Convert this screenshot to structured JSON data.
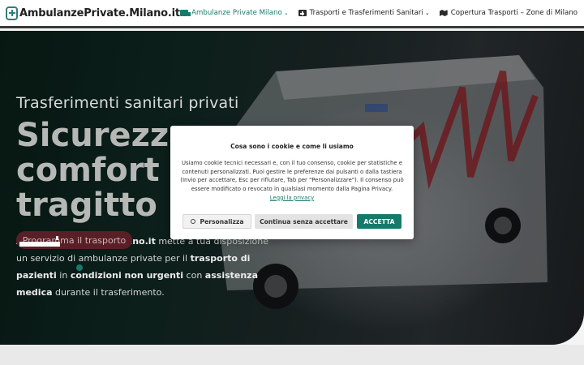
{
  "header": {
    "logo_text": "AmbulanzePrivate.Milano.it",
    "nav": [
      {
        "label": "Ambulanze Private Milano",
        "icon": "ambulance-icon",
        "active": true
      },
      {
        "label": "Trasporti e Trasferimenti Sanitari",
        "icon": "medical-kit-icon",
        "active": false
      },
      {
        "label": "Copertura Trasporti – Zone di Milano",
        "icon": "map-icon",
        "active": false
      }
    ]
  },
  "hero": {
    "subtitle": "Trasferimenti sanitari privati",
    "title": "Sicurezza e comfort in ogni tragitto",
    "text_brand": "AmbulanzePrivate.Milano.it",
    "text_1": " mette a tua disposizione un servizio di ambulanze private ",
    "text_2": "per il ",
    "text_bold_2": "trasporto di pazienti",
    "text_3": " in ",
    "text_bold_3": "condizioni non urgenti",
    "text_4": " con ",
    "text_bold_4": "assistenza medica",
    "text_5": " durante il trasferimento.",
    "cta_label": "Programma il trasporto"
  },
  "cookie": {
    "title": "Cosa sono i cookie e come li usiamo",
    "body": "Usiamo cookie tecnici necessari e, con il tuo consenso, cookie per statistiche e contenuti personalizzati. Puoi gestire le preferenze dai pulsanti o dalla tastiera (Invio per accettare, Esc per rifiutare, Tab per \"Personalizzare\"). Il consenso può essere modificato o revocato in qualsiasi momento dalla Pagina Privacy.",
    "link": "Leggi la privacy",
    "buttons": {
      "personalize": "Personalizza",
      "continue": "Continua senza accettare",
      "accept": "ACCETTA"
    }
  },
  "colors": {
    "accent": "#167a6a",
    "cta": "#7a2630"
  }
}
